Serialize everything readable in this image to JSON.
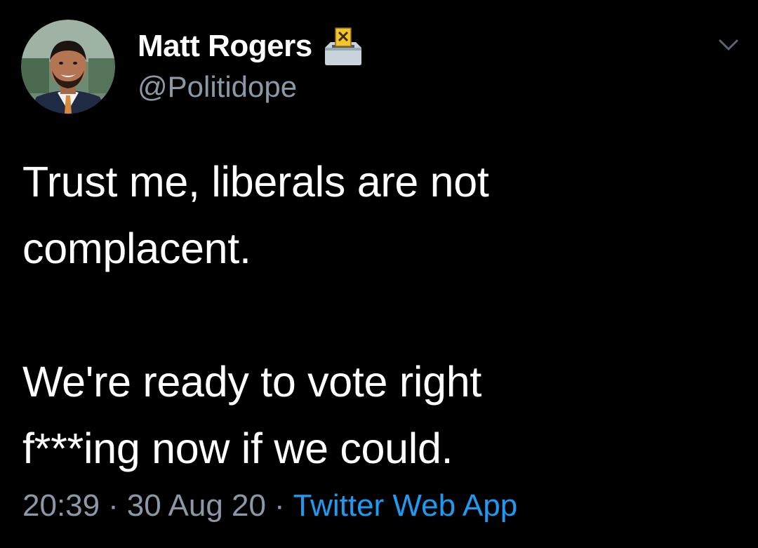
{
  "user": {
    "display_name": "Matt Rogers",
    "handle": "@Politidope",
    "badge_icon": "ballot-box-icon"
  },
  "tweet": {
    "lines_paragraph_1": [
      "Trust me, liberals are not",
      "complacent."
    ],
    "lines_paragraph_2": [
      "We're ready to vote right",
      "f***ing now if we could."
    ],
    "time": "20:39",
    "date": "30 Aug 20",
    "separator": "·",
    "source": "Twitter Web App"
  },
  "colors": {
    "background": "#000000",
    "text": "#ffffff",
    "secondary": "#8b98a5",
    "link": "#1d9bf0"
  },
  "icons": {
    "menu": "chevron-down-icon"
  }
}
